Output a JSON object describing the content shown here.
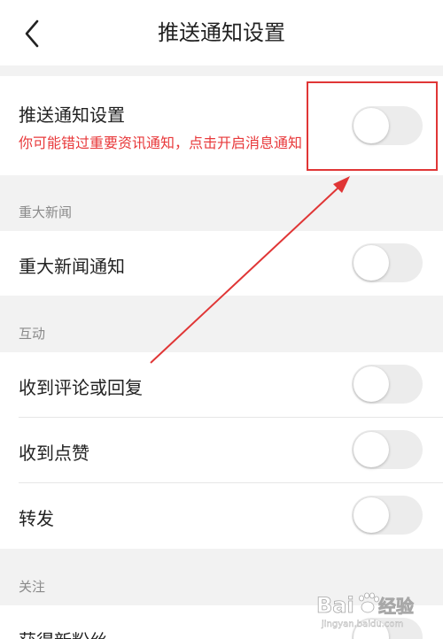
{
  "header": {
    "title": "推送通知设置",
    "back_icon": "chevron-left-icon"
  },
  "push_setting": {
    "label": "推送通知设置",
    "hint": "你可能错过重要资讯通知，点击开启消息通知",
    "enabled": false
  },
  "sections": {
    "major_news": {
      "title": "重大新闻",
      "items": [
        {
          "label": "重大新闻通知",
          "enabled": false
        }
      ]
    },
    "interaction": {
      "title": "互动",
      "items": [
        {
          "label": "收到评论或回复",
          "enabled": false
        },
        {
          "label": "收到点赞",
          "enabled": false
        },
        {
          "label": "转发",
          "enabled": false
        }
      ]
    },
    "follow": {
      "title": "关注",
      "items": [
        {
          "label": "获得新粉丝",
          "enabled": false
        }
      ]
    }
  },
  "annotation": {
    "color": "#e03636"
  },
  "watermark": {
    "brand": "Bai",
    "paw_icon": "baidu-paw-icon",
    "suffix": "经验",
    "domain": "jingyan.baidu.com"
  },
  "colors": {
    "background": "#f2f2f2",
    "hint_red": "#e8393b",
    "toggle_off": "#ececec"
  }
}
